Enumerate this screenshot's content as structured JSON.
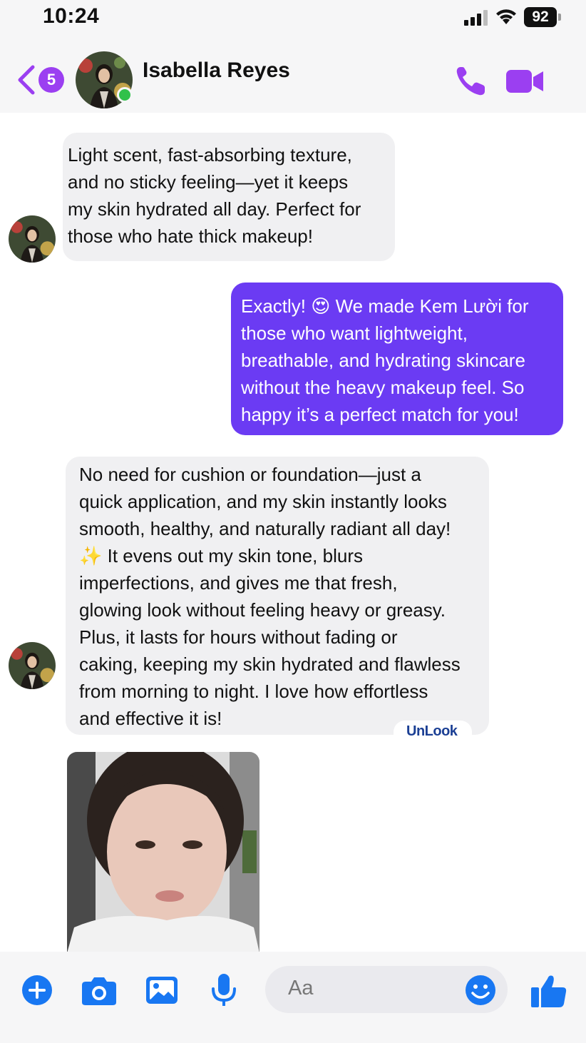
{
  "status_bar": {
    "time": "10:24",
    "battery": "92"
  },
  "header": {
    "back_count": "5",
    "contact_name": "Isabella Reyes"
  },
  "messages": [
    {
      "direction": "incoming",
      "lines": [
        "Light scent, fast-absorbing texture,",
        "and no sticky feeling—yet it keeps",
        "my skin hydrated all day. Perfect for",
        "those who hate thick makeup!"
      ]
    },
    {
      "direction": "outgoing",
      "lines": [
        "Exactly! 😍 We made Kem Lười for",
        "those who want lightweight,",
        "breathable, and hydrating skincare",
        "without the heavy makeup feel. So",
        "happy it’s a perfect match for you!"
      ]
    },
    {
      "direction": "incoming",
      "lines": [
        "No need for cushion or foundation—just a",
        "quick application, and my skin instantly looks",
        "smooth, healthy, and naturally radiant all day!",
        "✨ It evens out my skin tone, blurs",
        "imperfections, and gives me that fresh,",
        "glowing look without feeling heavy or greasy.",
        "Plus, it lasts for hours without fading or",
        "caking, keeping my skin hydrated and flawless",
        "from morning to night. I love how effortless",
        "and effective it is!"
      ]
    }
  ],
  "watermark": "UnLook",
  "composer": {
    "placeholder": "Aa"
  },
  "colors": {
    "accent": "#9b3ff1",
    "outgoing_bubble": "#6b3bf3",
    "incoming_bubble": "#f0f0f2",
    "composer_icons": "#1877f2"
  },
  "icons": [
    "signal-icon",
    "wifi-icon",
    "battery-icon",
    "back-chevron-icon",
    "phone-icon",
    "video-icon",
    "plus-icon",
    "camera-icon",
    "gallery-icon",
    "mic-icon",
    "emoji-icon",
    "thumbs-up-icon"
  ]
}
